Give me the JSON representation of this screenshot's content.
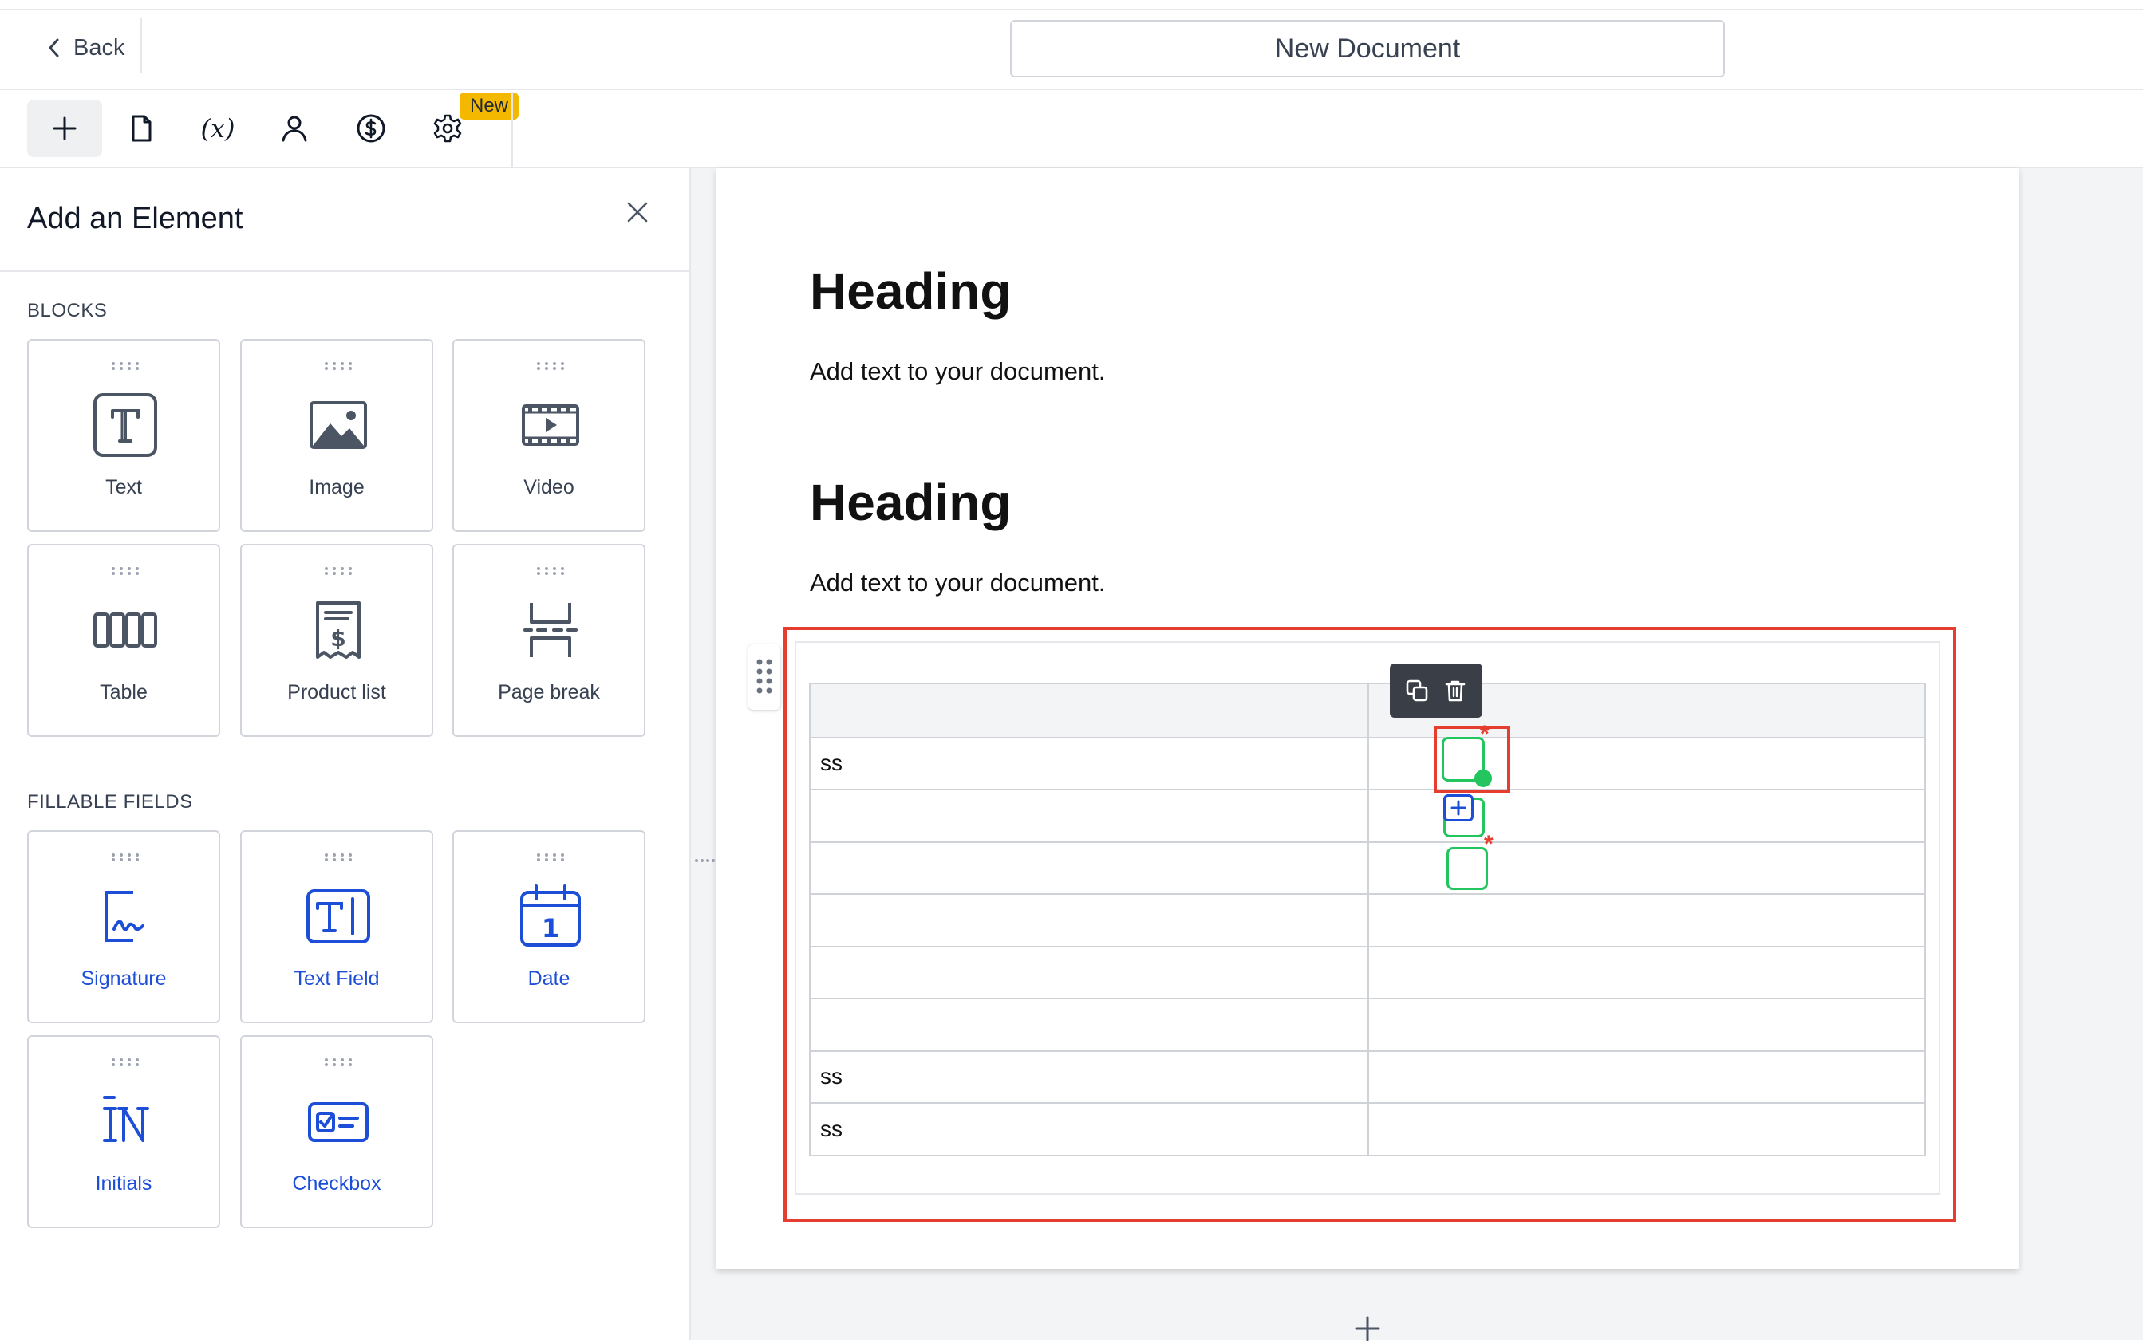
{
  "header": {
    "back_label": "Back",
    "document_title": "New Document"
  },
  "toolbar": {
    "items": [
      {
        "icon": "plus-icon"
      },
      {
        "icon": "document-icon"
      },
      {
        "label": "(x)",
        "icon": "variables-icon"
      },
      {
        "icon": "user-icon"
      },
      {
        "icon": "dollar-icon"
      },
      {
        "icon": "gear-icon"
      }
    ],
    "new_badge": "New"
  },
  "sidebar": {
    "title": "Add an Element",
    "blocks_label": "BLOCKS",
    "blocks": [
      {
        "label": "Text",
        "icon": "text-icon"
      },
      {
        "label": "Image",
        "icon": "image-icon"
      },
      {
        "label": "Video",
        "icon": "video-icon"
      },
      {
        "label": "Table",
        "icon": "table-icon"
      },
      {
        "label": "Product list",
        "icon": "product-list-icon"
      },
      {
        "label": "Page break",
        "icon": "page-break-icon"
      }
    ],
    "fillable_label": "FILLABLE FIELDS",
    "fillable": [
      {
        "label": "Signature",
        "icon": "signature-icon"
      },
      {
        "label": "Text Field",
        "icon": "text-field-icon"
      },
      {
        "label": "Date",
        "icon": "date-icon",
        "day": "1"
      },
      {
        "label": "Initials",
        "icon": "initials-icon"
      },
      {
        "label": "Checkbox",
        "icon": "checkbox-icon"
      }
    ]
  },
  "document": {
    "sections": [
      {
        "heading": "Heading",
        "text": "Add text to your document."
      },
      {
        "heading": "Heading",
        "text": "Add text to your document."
      }
    ],
    "table": {
      "rows": [
        [
          "",
          ""
        ],
        [
          "ss",
          ""
        ],
        [
          "",
          ""
        ],
        [
          "",
          ""
        ],
        [
          "",
          ""
        ],
        [
          "",
          ""
        ],
        [
          "",
          ""
        ],
        [
          "ss",
          ""
        ],
        [
          "ss",
          ""
        ]
      ]
    }
  },
  "colors": {
    "accent_blue": "#1d4ed8",
    "selection_red": "#e53e2f",
    "field_green": "#22c55e",
    "badge_yellow": "#f5b800"
  }
}
